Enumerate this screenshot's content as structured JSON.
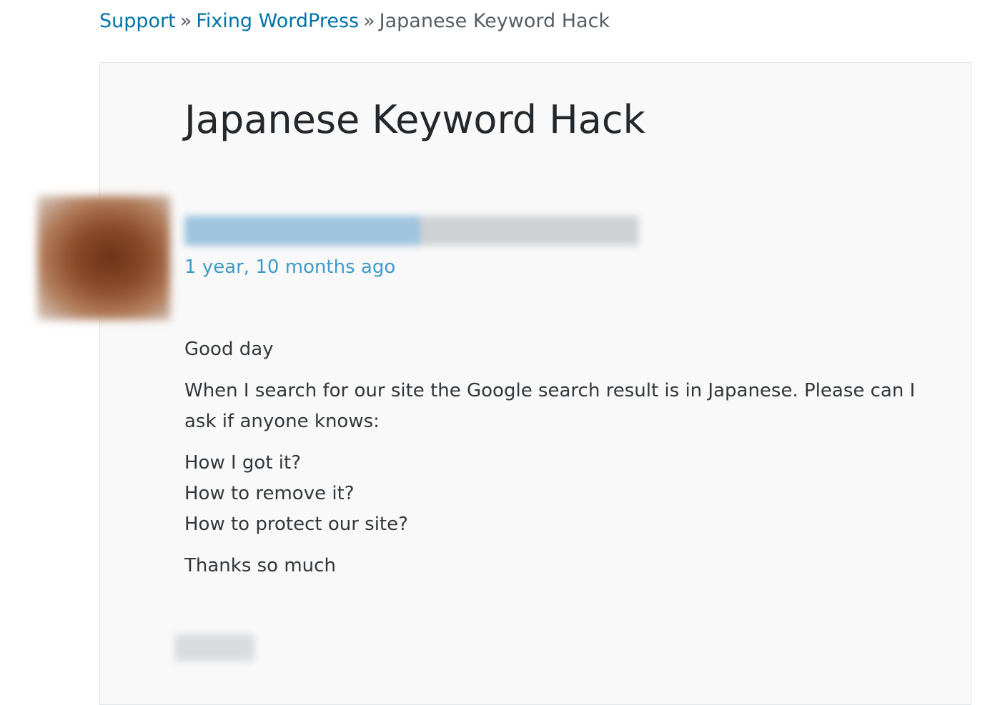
{
  "breadcrumb": {
    "items": [
      {
        "label": "Support"
      },
      {
        "label": "Fixing WordPress"
      }
    ],
    "separator": "»",
    "current": "Japanese Keyword Hack"
  },
  "topic": {
    "title": "Japanese Keyword Hack",
    "author": {
      "name": "",
      "meta": "",
      "avatar_icon": "user-avatar-blurred"
    },
    "timestamp": "1 year, 10 months ago",
    "body": {
      "greeting": "Good day",
      "paragraph": "When I search for our site the Google search result is in Japanese. Please can I ask if anyone knows:",
      "questions": [
        "How I got it?",
        "How to remove it?",
        "How to protect our site?"
      ],
      "closing": "Thanks so much"
    },
    "tag": ""
  },
  "colors": {
    "link": "#0073aa",
    "timestamp_link": "#3e9ac9",
    "text": "#32373c",
    "title": "#23282d",
    "box_background": "#f9f9f9",
    "box_border": "#e2e4e7"
  }
}
